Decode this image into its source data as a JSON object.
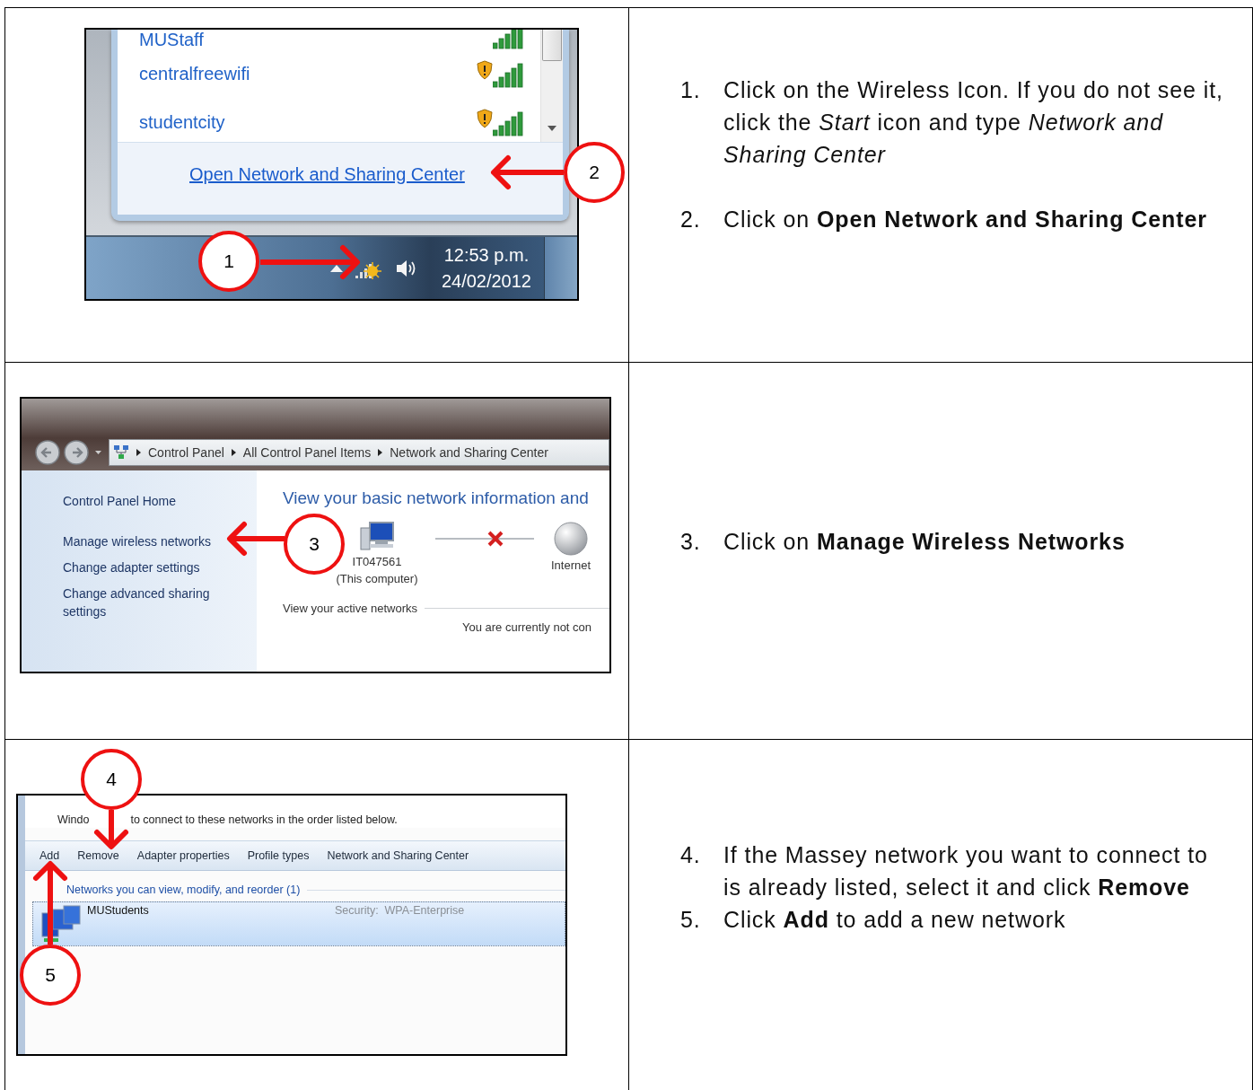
{
  "steps_table": {
    "rows": [
      {
        "screenshot": {
          "kind": "wifi_flyout",
          "networks": [
            {
              "name": "MUStaff",
              "secured": false
            },
            {
              "name": "centralfreewifi",
              "secured": true
            },
            {
              "name": "studentcity",
              "secured": true
            }
          ],
          "footer_link": "Open Network and Sharing Center",
          "clock": {
            "time": "12:53 p.m.",
            "date": "24/02/2012"
          }
        },
        "instructions": [
          {
            "number": "1.",
            "text": "Click on the Wireless Icon. If you do not see it, click the *Start* icon and type *Network and Sharing Center*"
          },
          {
            "number": "2.",
            "text": "Click on **Open Network and Sharing Center**"
          }
        ]
      },
      {
        "screenshot": {
          "kind": "control_panel",
          "breadcrumb": [
            "Control Panel",
            "All Control Panel Items",
            "Network and Sharing Center"
          ],
          "nav_links": [
            "Control Panel Home",
            "Manage wireless networks",
            "Change adapter settings",
            "Change advanced sharing settings"
          ],
          "heading": "View your basic network information and",
          "map": {
            "computer_name": "IT047561",
            "computer_caption": "(This computer)",
            "connected": false,
            "internet_label": "Internet"
          },
          "active_networks_label": "View your active networks",
          "status_text": "You are currently not con"
        },
        "instructions": [
          {
            "number": "3.",
            "text": "Click on **Manage Wireless Networks**"
          }
        ]
      },
      {
        "screenshot": {
          "kind": "manage_wireless",
          "description": [
            "Windo",
            "to connect to these networks in the order listed below."
          ],
          "toolbar": [
            "Add",
            "Remove",
            "Adapter properties",
            "Profile types",
            "Network and Sharing Center"
          ],
          "group_header": "Networks you can view, modify, and reorder (1)",
          "networks": [
            {
              "name": "MUStudents",
              "security": "Security:  WPA-Enterprise",
              "selected": true
            }
          ]
        },
        "instructions": [
          {
            "number": "4.",
            "text": "If the Massey network you want to connect to is already listed, select it and click **Remove**"
          },
          {
            "number": "5.",
            "text": "Click **Add** to add a new network"
          }
        ]
      }
    ]
  },
  "callouts": [
    {
      "number": "1"
    },
    {
      "number": "2"
    },
    {
      "number": "3"
    },
    {
      "number": "4"
    },
    {
      "number": "5"
    }
  ]
}
